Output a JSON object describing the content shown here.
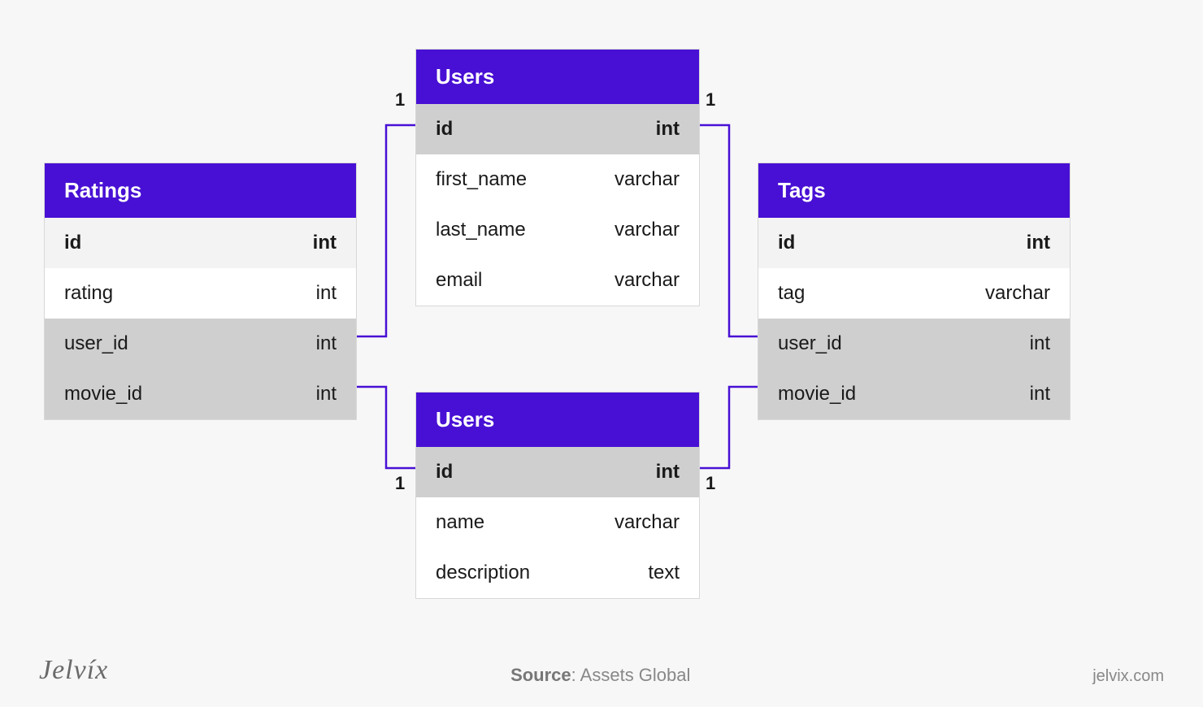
{
  "colors": {
    "accent": "#4810d4"
  },
  "tables": {
    "ratings": {
      "title": "Ratings",
      "rows": [
        {
          "name": "id",
          "type": "int",
          "pk": true,
          "shade": "light"
        },
        {
          "name": "rating",
          "type": "int",
          "shade": "white"
        },
        {
          "name": "user_id",
          "type": "int",
          "shade": "grey"
        },
        {
          "name": "movie_id",
          "type": "int",
          "shade": "grey"
        }
      ]
    },
    "users1": {
      "title": "Users",
      "rows": [
        {
          "name": "id",
          "type": "int",
          "pk": true,
          "shade": "grey"
        },
        {
          "name": "first_name",
          "type": "varchar",
          "shade": "white"
        },
        {
          "name": "last_name",
          "type": "varchar",
          "shade": "white"
        },
        {
          "name": "email",
          "type": "varchar",
          "shade": "white"
        }
      ]
    },
    "users2": {
      "title": "Users",
      "rows": [
        {
          "name": "id",
          "type": "int",
          "pk": true,
          "shade": "grey"
        },
        {
          "name": "name",
          "type": "varchar",
          "shade": "white"
        },
        {
          "name": "description",
          "type": "text",
          "shade": "white"
        }
      ]
    },
    "tags": {
      "title": "Tags",
      "rows": [
        {
          "name": "id",
          "type": "int",
          "pk": true,
          "shade": "light"
        },
        {
          "name": "tag",
          "type": "varchar",
          "shade": "white"
        },
        {
          "name": "user_id",
          "type": "int",
          "shade": "grey"
        },
        {
          "name": "movie_id",
          "type": "int",
          "shade": "grey"
        }
      ]
    }
  },
  "cardinality": {
    "c1": "1",
    "c2": "1",
    "c3": "1",
    "c4": "1"
  },
  "footer": {
    "logo": "Jelvíx",
    "source_label": "Source",
    "source_value": "Assets Global",
    "site": "jelvix.com"
  }
}
